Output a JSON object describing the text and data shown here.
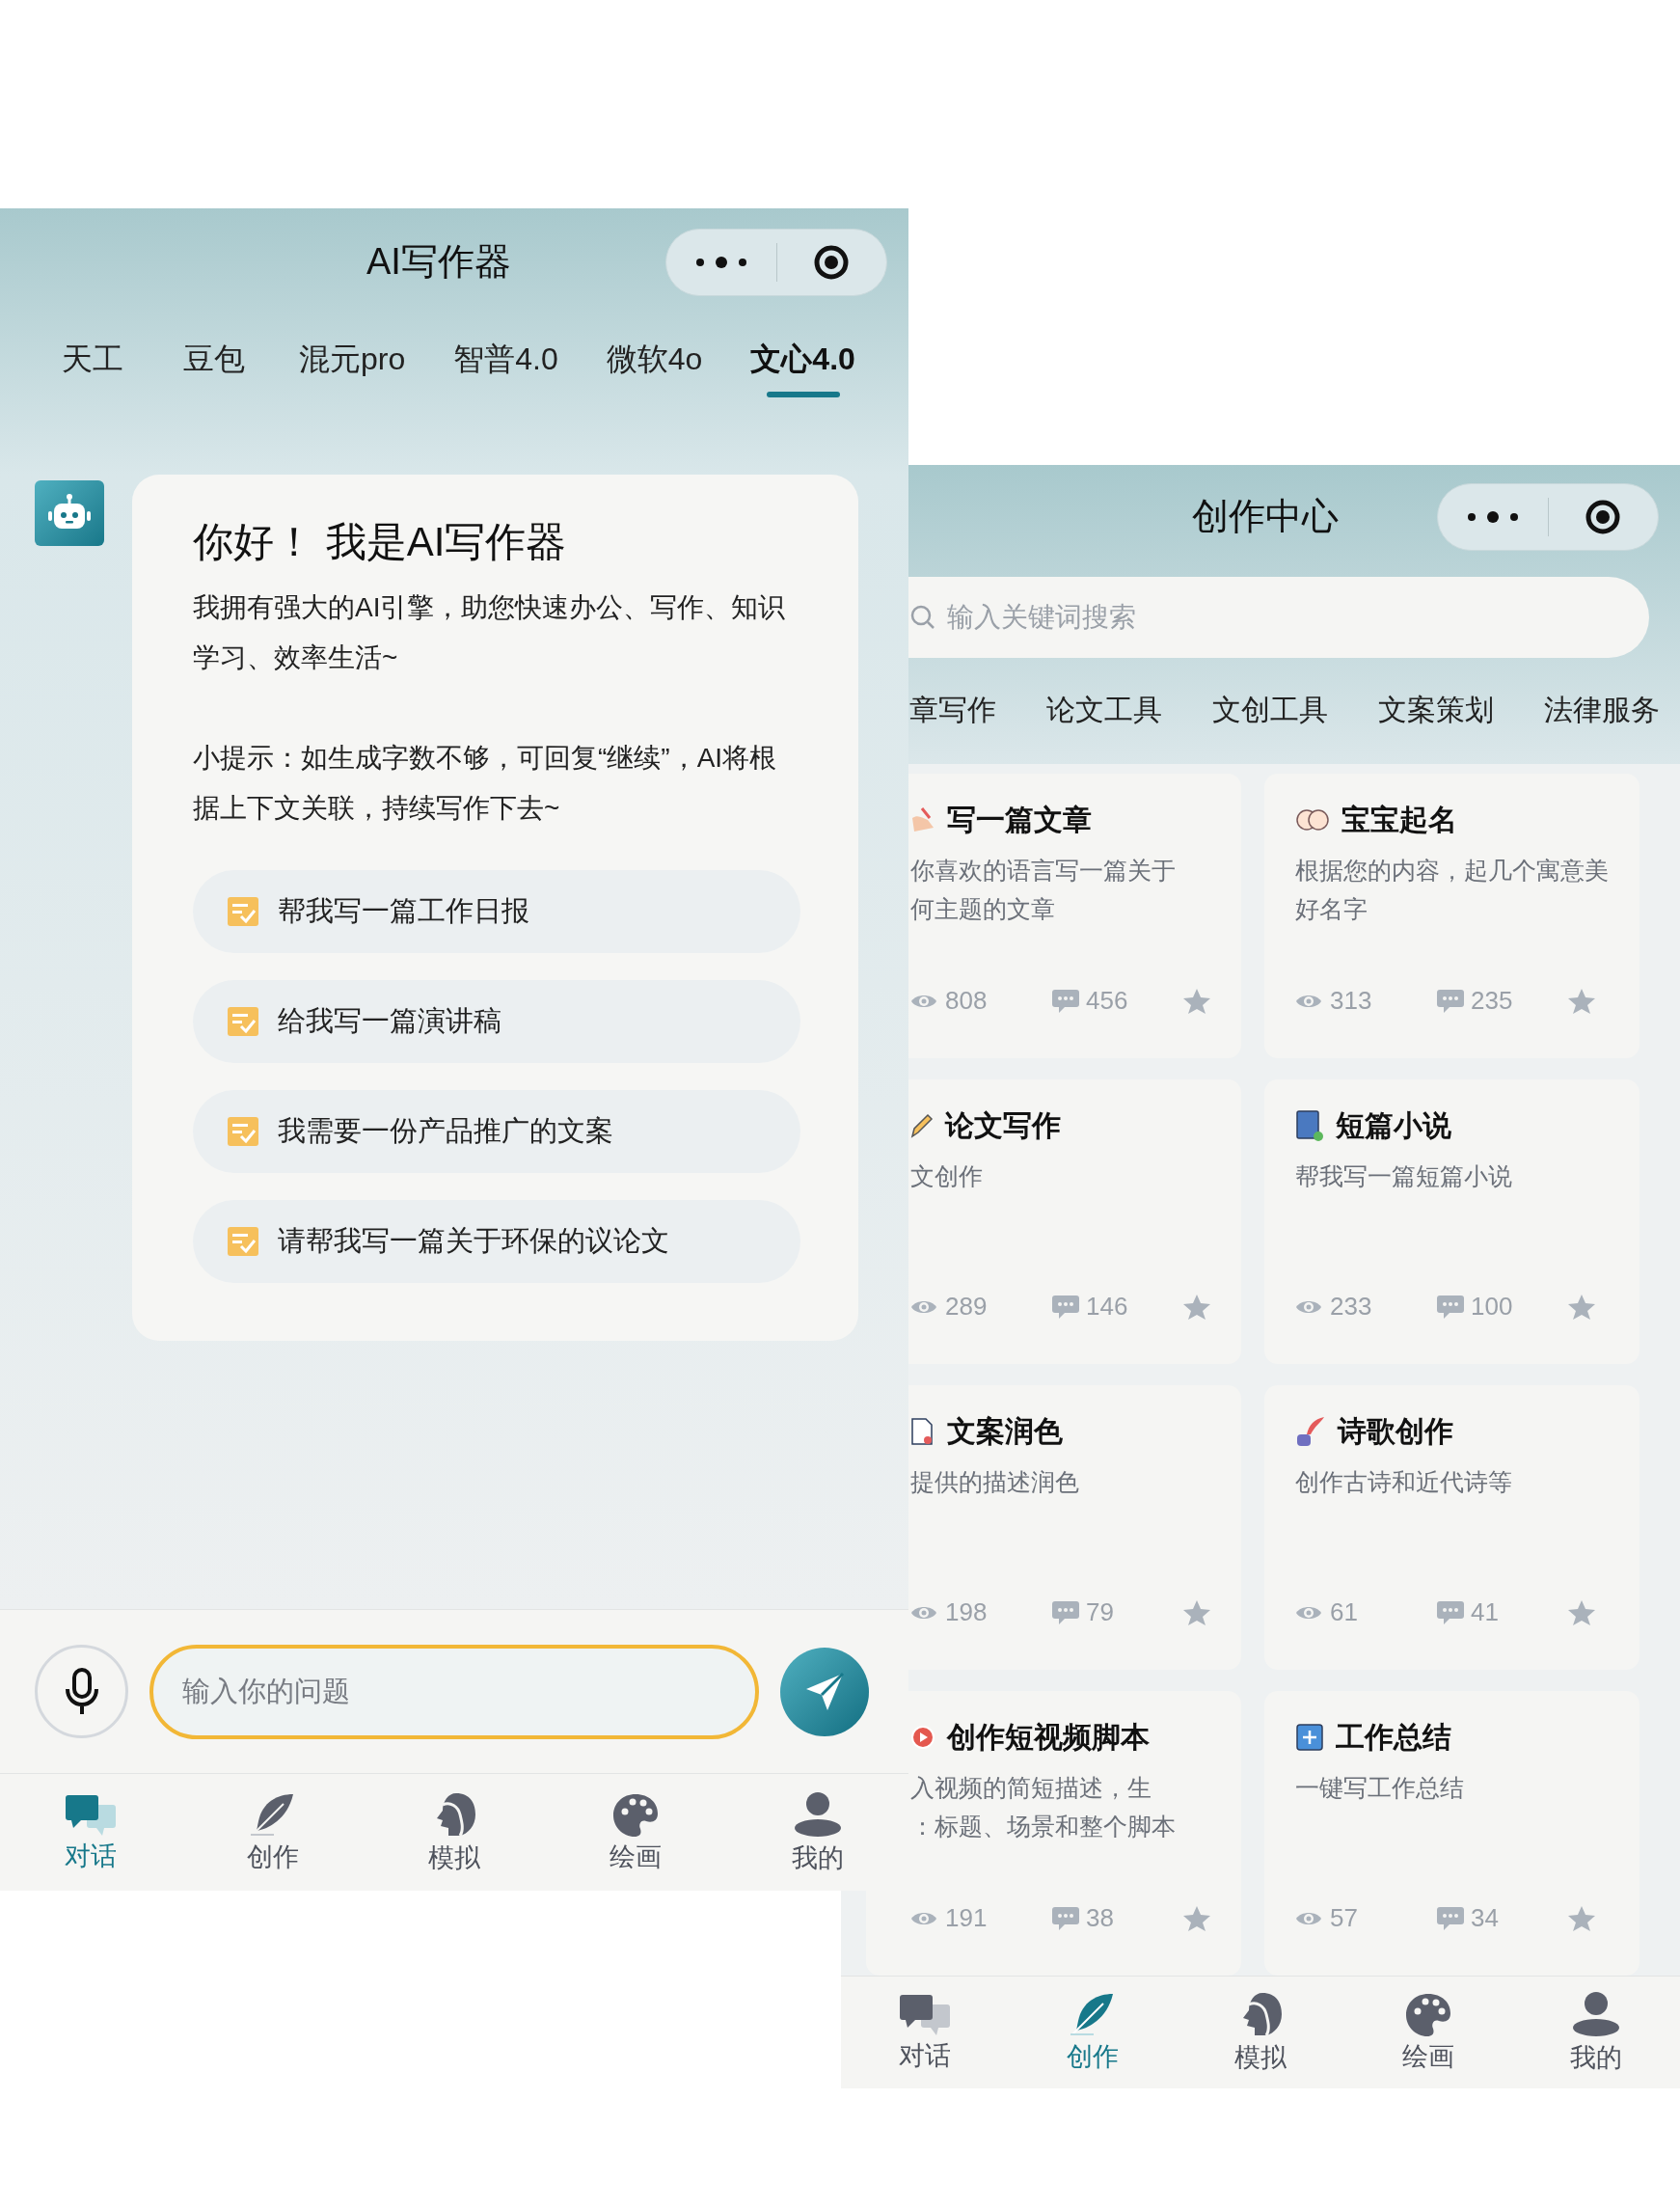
{
  "chat_screen": {
    "title": "AI写作器",
    "model_tabs": [
      {
        "label": "天工",
        "selected": false
      },
      {
        "label": "豆包",
        "selected": false
      },
      {
        "label": "混元pro",
        "selected": false
      },
      {
        "label": "智普4.0",
        "selected": false
      },
      {
        "label": "微软4o",
        "selected": false
      },
      {
        "label": "文心4.0",
        "selected": true
      }
    ],
    "greeting": "你好！ 我是AI写作器",
    "intro": "我拥有强大的AI引擎，助您快速办公、写作、知识学习、效率生活~",
    "tip": "小提示：如生成字数不够，可回复“继续”，AI将根据上下文关联，持续写作下去~",
    "suggestions": [
      "帮我写一篇工作日报",
      "给我写一篇演讲稿",
      "我需要一份产品推广的文案",
      "请帮我写一篇关于环保的议论文"
    ],
    "input": {
      "placeholder": "输入你的问题"
    },
    "tab_bar": [
      {
        "label": "对话",
        "selected": true
      },
      {
        "label": "创作",
        "selected": false
      },
      {
        "label": "模拟",
        "selected": false
      },
      {
        "label": "绘画",
        "selected": false
      },
      {
        "label": "我的",
        "selected": false
      }
    ]
  },
  "creation_screen": {
    "title": "创作中心",
    "search": {
      "placeholder": "输入关键词搜索"
    },
    "category_tabs": [
      "章写作",
      "论文工具",
      "文创工具",
      "文案策划",
      "法律服务"
    ],
    "cards": [
      {
        "title": "写一篇文章",
        "description": [
          "你喜欢的语言写一篇关于",
          "何主题的文章"
        ],
        "views": "808",
        "comments": "456"
      },
      {
        "title": "宝宝起名",
        "description": [
          "根据您的内容，起几个寓意美好名字"
        ],
        "views": "313",
        "comments": "235"
      },
      {
        "title": "论文写作",
        "description": [
          "文创作"
        ],
        "views": "289",
        "comments": "146"
      },
      {
        "title": "短篇小说",
        "description": [
          "帮我写一篇短篇小说"
        ],
        "views": "233",
        "comments": "100"
      },
      {
        "title": "文案润色",
        "description": [
          "提供的描述润色"
        ],
        "views": "198",
        "comments": "79"
      },
      {
        "title": "诗歌创作",
        "description": [
          "创作古诗和近代诗等"
        ],
        "views": "61",
        "comments": "41"
      },
      {
        "title": "创作短视频脚本",
        "description": [
          "入视频的简短描述，生",
          "：标题、场景和整个脚本"
        ],
        "views": "191",
        "comments": "38"
      },
      {
        "title": "工作总结",
        "description": [
          "一键写工作总结"
        ],
        "views": "57",
        "comments": "34"
      }
    ],
    "tab_bar": [
      {
        "label": "对话",
        "selected": false
      },
      {
        "label": "创作",
        "selected": true
      },
      {
        "label": "模拟",
        "selected": false
      },
      {
        "label": "绘画",
        "selected": false
      },
      {
        "label": "我的",
        "selected": false
      }
    ]
  }
}
